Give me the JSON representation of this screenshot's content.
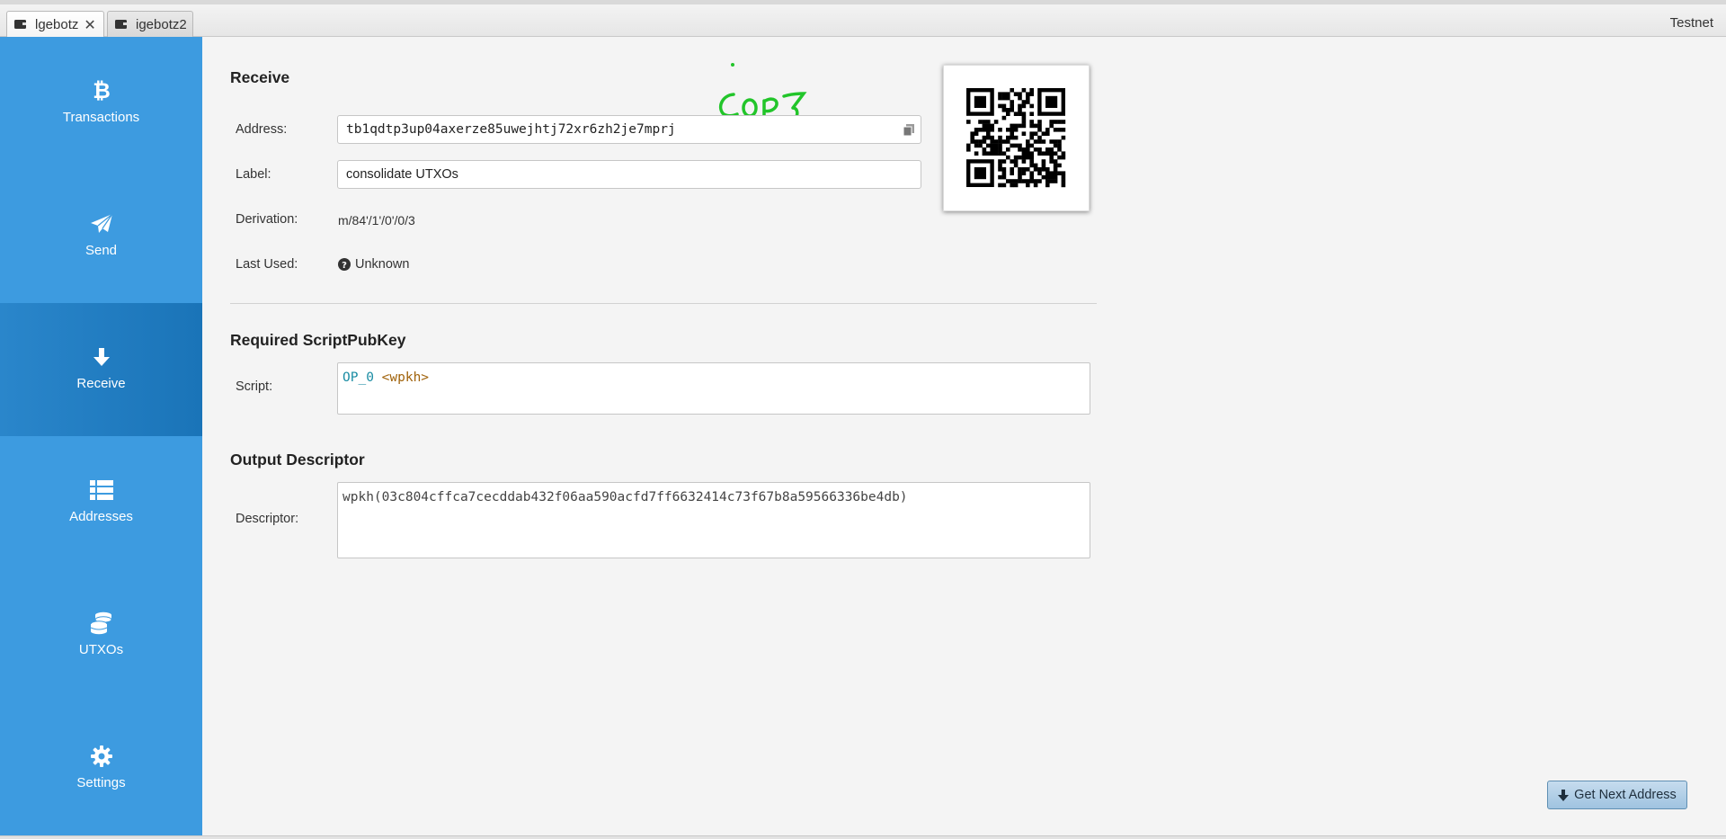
{
  "tabs": [
    {
      "label": "lgebotz",
      "active": true
    },
    {
      "label": "igebotz2",
      "active": false
    }
  ],
  "network": "Testnet",
  "sidebar": {
    "items": [
      {
        "label": "Transactions",
        "icon": "bitcoin-icon"
      },
      {
        "label": "Send",
        "icon": "paper-plane-icon"
      },
      {
        "label": "Receive",
        "icon": "arrow-down-icon",
        "active": true
      },
      {
        "label": "Addresses",
        "icon": "list-icon"
      },
      {
        "label": "UTXOs",
        "icon": "coins-icon"
      },
      {
        "label": "Settings",
        "icon": "gear-icon"
      }
    ]
  },
  "receive": {
    "title": "Receive",
    "address_label": "Address:",
    "address_value": "tb1qdtp3up04axerze85uwejhtj72xr6zh2je7mprj",
    "label_label": "Label:",
    "label_value": "consolidate UTXOs",
    "derivation_label": "Derivation:",
    "derivation_value": "m/84'/1'/0'/0/3",
    "last_used_label": "Last Used:",
    "last_used_value": "Unknown"
  },
  "script_section": {
    "title": "Required ScriptPubKey",
    "label": "Script:",
    "op": "OP_0",
    "arg": "<wpkh>"
  },
  "descriptor_section": {
    "title": "Output Descriptor",
    "label": "Descriptor:",
    "value": "wpkh(03c804cffca7cecddab432f06aa590acfd7ff6632414c73f67b8a59566336be4db)"
  },
  "annotation": "COPY",
  "buttons": {
    "next_address": "Get Next Address"
  },
  "colors": {
    "sidebar": "#3d9be0",
    "sidebar_active": "#1a74b8",
    "op_code": "#1a8ca3",
    "op_arg": "#a0620a",
    "annotation": "#22c52a"
  }
}
